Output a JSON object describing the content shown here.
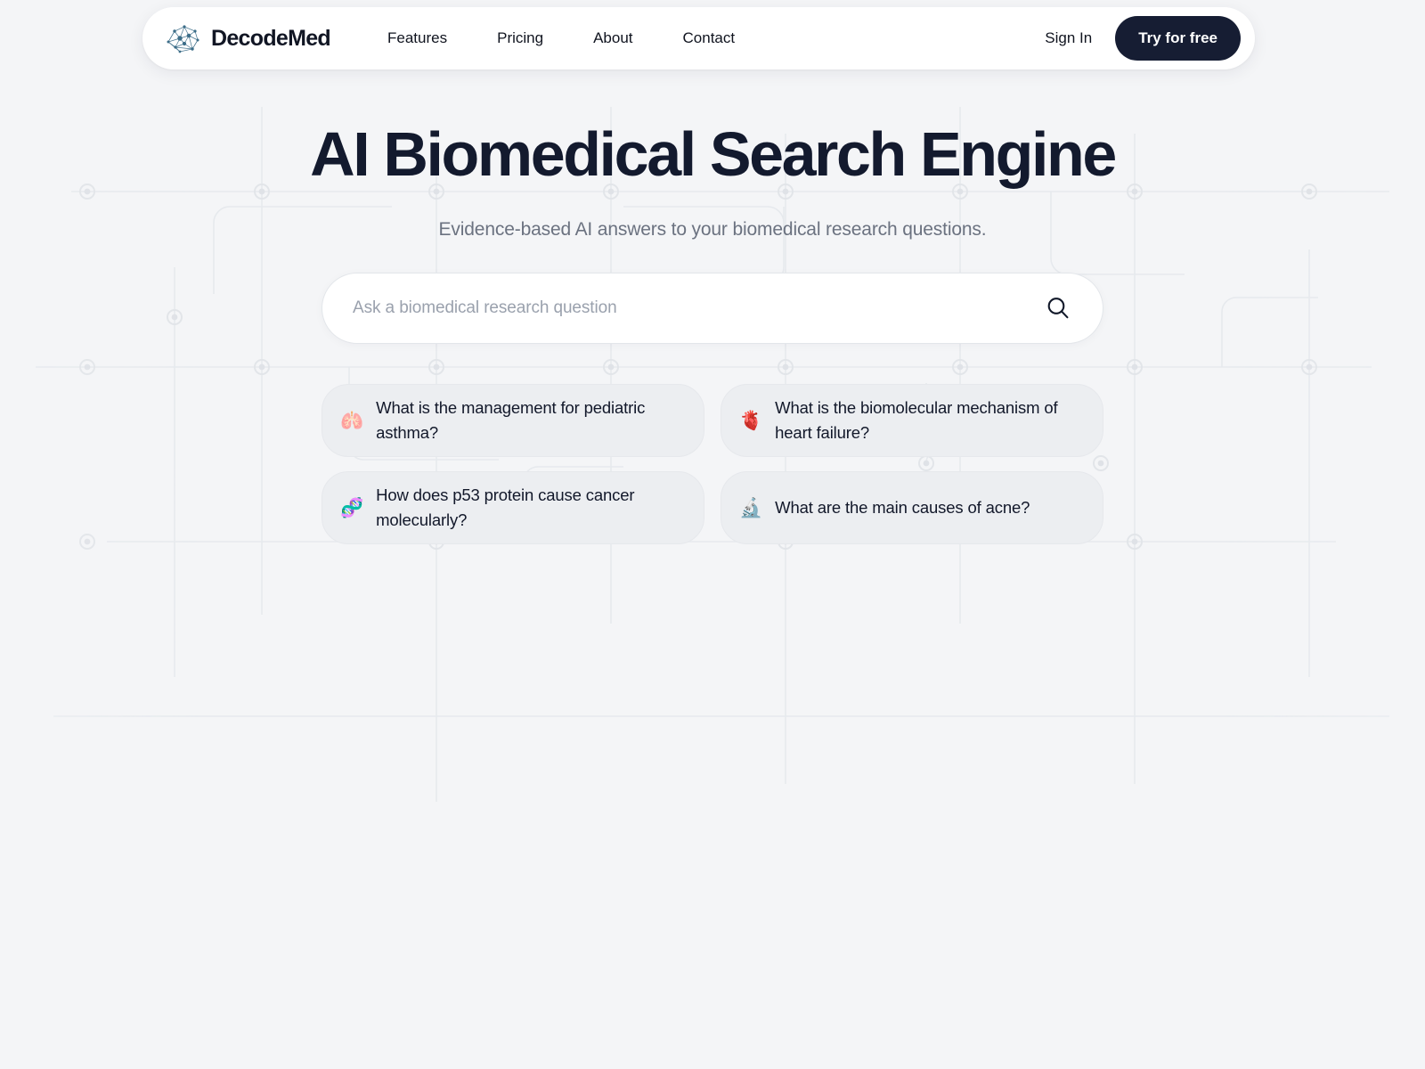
{
  "brand": {
    "name": "DecodeMed",
    "logo_icon": "brain-network-icon",
    "logo_color": "#3c6d88"
  },
  "nav": {
    "items": [
      {
        "label": "Features"
      },
      {
        "label": "Pricing"
      },
      {
        "label": "About"
      },
      {
        "label": "Contact"
      }
    ],
    "sign_in_label": "Sign In",
    "cta_label": "Try for free",
    "cta_color": "#161d33"
  },
  "hero": {
    "title": "AI Biomedical Search Engine",
    "subtitle": "Evidence-based AI answers to your biomedical research questions.",
    "title_color": "#131a2e",
    "subtitle_color": "#6b7280"
  },
  "search": {
    "value": "",
    "placeholder": "Ask a biomedical research question",
    "icon": "search-icon"
  },
  "suggestions": [
    {
      "emoji": "🫁",
      "icon_name": "lungs-emoji",
      "text": "What is the management for pediatric asthma?"
    },
    {
      "emoji": "🫀",
      "icon_name": "anatomical-heart-emoji",
      "text": "What is the biomolecular mechanism of heart failure?"
    },
    {
      "emoji": "🧬",
      "icon_name": "dna-emoji",
      "text": "How does p53 protein cause cancer molecularly?"
    },
    {
      "emoji": "🔬",
      "icon_name": "microscope-emoji",
      "text": "What are the main causes of acne?"
    }
  ],
  "theme": {
    "page_background": "#f4f5f7",
    "header_background": "#ffffff",
    "chip_background": "#eceef1"
  }
}
